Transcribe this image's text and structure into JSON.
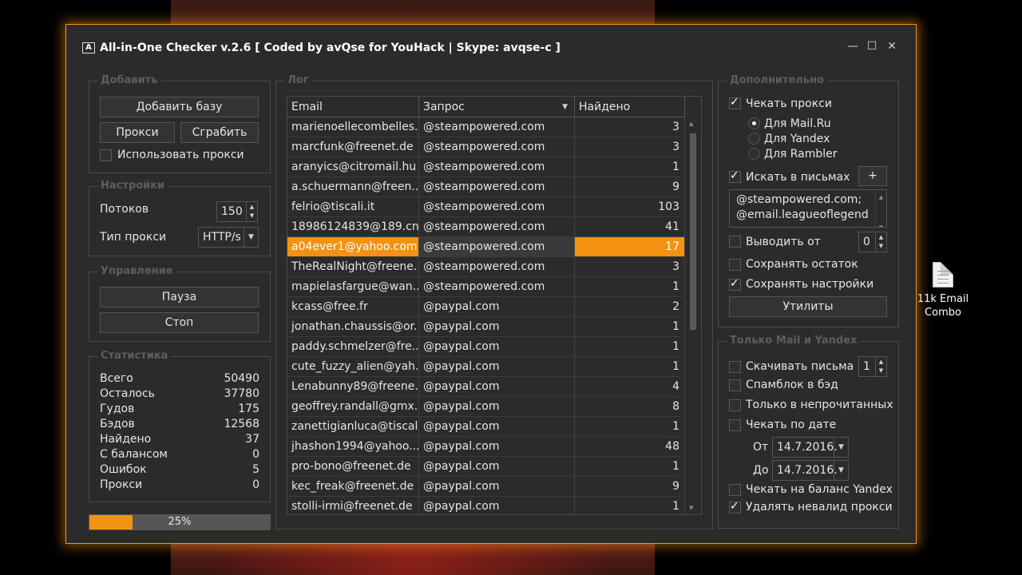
{
  "window": {
    "title": "All-in-One Checker v.2.6  [ Coded by avQse for YouHack | Skype: avqse-c ]",
    "app_icon": "A",
    "min_glyph": "—",
    "max_glyph": "☐",
    "close_glyph": "✕"
  },
  "desktop": {
    "file_label_1": "11k  Email",
    "file_label_2": "Combo"
  },
  "add": {
    "group": "Добавить",
    "add_base": "Добавить базу",
    "proxy": "Прокси",
    "grab": "Сграбить",
    "use_proxy": "Использовать прокси"
  },
  "settings": {
    "group": "Настройки",
    "threads_label": "Потоков",
    "threads_value": "150",
    "proxy_type_label": "Тип прокси",
    "proxy_type_value": "HTTP/s"
  },
  "control": {
    "group": "Управление",
    "pause": "Пауза",
    "stop": "Стоп"
  },
  "stats": {
    "group": "Статистика",
    "rows": [
      {
        "k": "Всего",
        "v": "50490"
      },
      {
        "k": "Осталось",
        "v": "37780"
      },
      {
        "k": "Гудов",
        "v": "175"
      },
      {
        "k": "Бэдов",
        "v": "12568"
      },
      {
        "k": "Найдено",
        "v": "37"
      },
      {
        "k": "С балансом",
        "v": "0"
      },
      {
        "k": "Ошибок",
        "v": "5"
      },
      {
        "k": "Прокси",
        "v": "0"
      }
    ]
  },
  "progress": {
    "value": 25,
    "label": "25%"
  },
  "log": {
    "group": "Лог",
    "columns": [
      "Email",
      "Запрос",
      "Найдено"
    ],
    "rows": [
      [
        "marienoellecombelles...",
        "@steampowered.com",
        "3"
      ],
      [
        "marcfunk@freenet.de",
        "@steampowered.com",
        "3"
      ],
      [
        "aranyics@citromail.hu",
        "@steampowered.com",
        "1"
      ],
      [
        "a.schuermann@freen...",
        "@steampowered.com",
        "9"
      ],
      [
        "felrio@tiscali.it",
        "@steampowered.com",
        "103"
      ],
      [
        "18986124839@189.cn",
        "@steampowered.com",
        "41"
      ],
      [
        "a04ever1@yahoo.com",
        "@steampowered.com",
        "17"
      ],
      [
        "TheRealNight@freene...",
        "@steampowered.com",
        "3"
      ],
      [
        "mapielasfargue@wan...",
        "@steampowered.com",
        "1"
      ],
      [
        "kcass@free.fr",
        "@paypal.com",
        "2"
      ],
      [
        "jonathan.chaussis@or...",
        "@paypal.com",
        "1"
      ],
      [
        "paddy.schmelzer@fre...",
        "@paypal.com",
        "1"
      ],
      [
        "cute_fuzzy_alien@yah...",
        "@paypal.com",
        "1"
      ],
      [
        "Lenabunny89@freene...",
        "@paypal.com",
        "4"
      ],
      [
        "geoffrey.randall@gmx...",
        "@paypal.com",
        "8"
      ],
      [
        "zanettigianluca@tiscal...",
        "@paypal.com",
        "1"
      ],
      [
        "jhashon1994@yahoo....",
        "@paypal.com",
        "48"
      ],
      [
        "pro-bono@freenet.de",
        "@paypal.com",
        "1"
      ],
      [
        "kec_freak@freenet.de",
        "@paypal.com",
        "9"
      ],
      [
        "stolli-irmi@freenet.de",
        "@paypal.com",
        "1"
      ]
    ],
    "selected_row": 6
  },
  "extra": {
    "group": "Дополнительно",
    "check_proxy": "Чекать прокси",
    "mailru": "Для Mail.Ru",
    "yandex": "Для Yandex",
    "rambler": "Для Rambler",
    "search_letters": "Искать в письмах",
    "plus": "+",
    "search_text": "@steampowered.com;@email.leagueoflegends.co",
    "output_from": "Выводить от",
    "output_from_value": "0",
    "save_rest": "Сохранять остаток",
    "save_settings": "Сохранять настройки",
    "utilities": "Утилиты"
  },
  "mail_yandex": {
    "group": "Только Mail и Yandex",
    "download_letters": "Скачивать письма",
    "download_value": "1",
    "spamblock": "Спамблок в бэд",
    "unread_only": "Только в непрочитанных",
    "check_by_date": "Чекать по дате",
    "from_label": "От",
    "from_date": "14.7.2016.",
    "to_label": "До",
    "to_date": "14.7.2016.",
    "check_balance": "Чекать на баланс Yandex",
    "delete_invalid": "Удалять невалид прокси"
  },
  "colors": {
    "accent": "#f39212",
    "window_bg": "#2b2b2b"
  }
}
